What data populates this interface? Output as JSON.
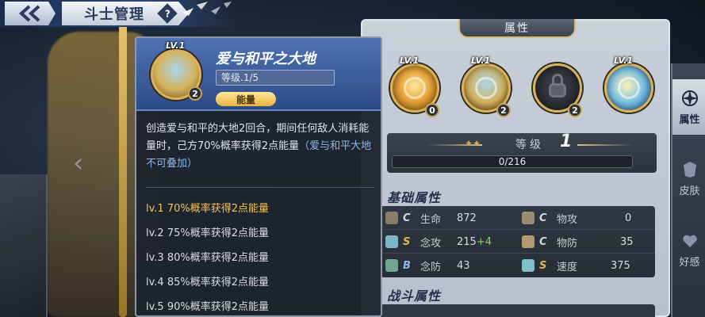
{
  "header": {
    "title": "斗士管理",
    "help_label": "?"
  },
  "popup": {
    "lv_badge": "LV.1",
    "count": "2",
    "skill_name": "爱与和平之大地",
    "level_text": "等级.1/5",
    "type_label": "能量",
    "description": "创造爱与和平的大地2回合，期间任何敌人消耗能量时，己方70%概率获得2点能量",
    "description_note": "（爱与和平大地不可叠加）",
    "levels": [
      "lv.1 70%概率获得2点能量",
      "lv.2 75%概率获得2点能量",
      "lv.3 80%概率获得2点能量",
      "lv.4 85%概率获得2点能量",
      "lv.5 90%概率获得2点能量"
    ]
  },
  "attr_panel": {
    "tab_title": "属性",
    "skills": [
      {
        "lv": "LV.1",
        "count": "0",
        "icon": "phoenix-skill-icon"
      },
      {
        "lv": "LV.1",
        "count": "2",
        "icon": "earth-skill-icon"
      },
      {
        "lv": "",
        "count": "2",
        "icon": "lock-icon"
      },
      {
        "lv": "LV.1",
        "count": "",
        "icon": "comet-skill-icon"
      }
    ],
    "level_label": "等级",
    "level_value": "1",
    "exp_text": "0/216",
    "exp_progress": 0,
    "basic_title": "基础属性",
    "stats": [
      {
        "grade": "C",
        "name": "生命",
        "value": "872",
        "plus": ""
      },
      {
        "grade": "C",
        "name": "物攻",
        "value": "0",
        "plus": ""
      },
      {
        "grade": "S",
        "name": "念攻",
        "value": "215",
        "plus": "+4"
      },
      {
        "grade": "C",
        "name": "物防",
        "value": "35",
        "plus": ""
      },
      {
        "grade": "B",
        "name": "念防",
        "value": "43",
        "plus": ""
      },
      {
        "grade": "S",
        "name": "速度",
        "value": "375",
        "plus": ""
      }
    ],
    "combat_title": "战斗属性"
  },
  "side_tabs": [
    {
      "label": "属性",
      "active": true
    },
    {
      "label": "皮肤",
      "active": false
    },
    {
      "label": "好感",
      "active": false
    }
  ],
  "colors": {
    "accent_gold": "#d8b15a",
    "popup_head": "#3a5d9c",
    "current_level": "#f0c35a",
    "note_blue": "#8ab4ee"
  }
}
